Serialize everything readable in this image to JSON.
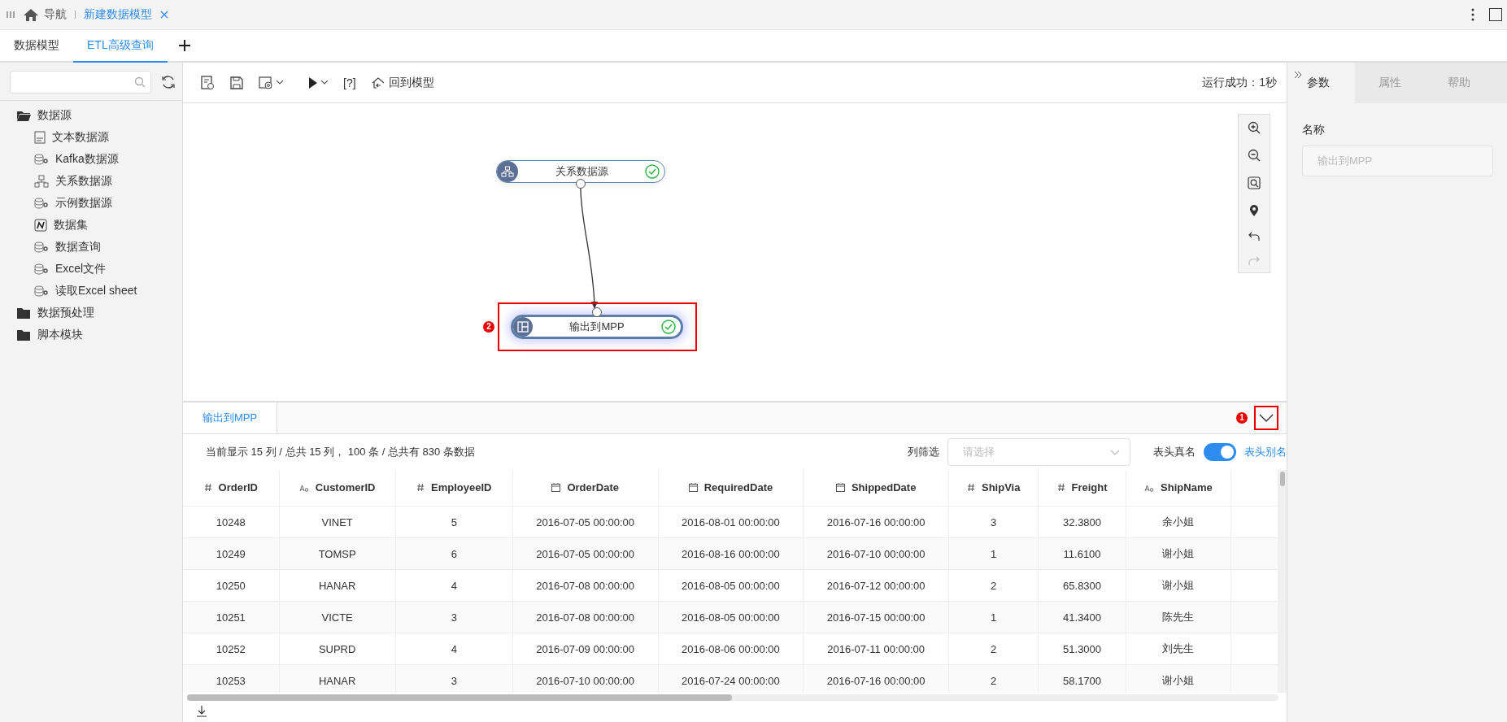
{
  "top_bar": {
    "nav_label": "导航",
    "open_tab": {
      "title": "新建数据模型",
      "selected": true
    }
  },
  "model_tabs": [
    {
      "label": "数据模型",
      "selected": false
    },
    {
      "label": "ETL高级查询",
      "selected": true
    }
  ],
  "sidebar": {
    "items": [
      {
        "label": "数据源",
        "kind": "folder",
        "expanded": true,
        "children": [
          {
            "label": "文本数据源",
            "kind": "text"
          },
          {
            "label": "Kafka数据源",
            "kind": "db"
          },
          {
            "label": "关系数据源",
            "kind": "relation"
          },
          {
            "label": "示例数据源",
            "kind": "db"
          },
          {
            "label": "数据集",
            "kind": "dataset"
          },
          {
            "label": "数据查询",
            "kind": "db"
          },
          {
            "label": "Excel文件",
            "kind": "db"
          },
          {
            "label": "读取Excel sheet",
            "kind": "db"
          }
        ]
      },
      {
        "label": "数据预处理",
        "kind": "folder",
        "expanded": false
      },
      {
        "label": "脚本模块",
        "kind": "folder",
        "expanded": false
      }
    ]
  },
  "toolbar": {
    "help": "[?]",
    "back_label": "回到模型",
    "status": "运行成功：1秒"
  },
  "canvas": {
    "nodes": [
      {
        "label": "关系数据源",
        "kind": "relation",
        "succeeded": true,
        "selected": false
      },
      {
        "label": "输出到MPP",
        "kind": "output",
        "succeeded": true,
        "selected": true,
        "badge": "2"
      }
    ],
    "tools": [
      {
        "kind": "zoom-in",
        "disabled": false
      },
      {
        "kind": "zoom-out",
        "disabled": false
      },
      {
        "kind": "fit",
        "disabled": false
      },
      {
        "kind": "locate",
        "disabled": false
      },
      {
        "kind": "undo",
        "disabled": false
      },
      {
        "kind": "redo",
        "disabled": true
      }
    ]
  },
  "result_panel": {
    "tabs": [
      {
        "label": "输出到MPP",
        "selected": true
      }
    ],
    "badge": "1",
    "summary": "当前显示 15 列 / 总共 15 列， 100 条 / 总共有 830 条数据",
    "filter": {
      "label": "列筛选",
      "placeholder": "请选择"
    },
    "header_toggle": {
      "label": "表头真名",
      "on": true,
      "alt_label": "表头别名"
    },
    "table": {
      "columns": [
        {
          "name": "OrderID",
          "kind": "number"
        },
        {
          "name": "CustomerID",
          "kind": "text"
        },
        {
          "name": "EmployeeID",
          "kind": "number"
        },
        {
          "name": "OrderDate",
          "kind": "date"
        },
        {
          "name": "RequiredDate",
          "kind": "date"
        },
        {
          "name": "ShippedDate",
          "kind": "date"
        },
        {
          "name": "ShipVia",
          "kind": "number"
        },
        {
          "name": "Freight",
          "kind": "number"
        },
        {
          "name": "ShipName",
          "kind": "text"
        }
      ],
      "rows": [
        [
          "10248",
          "VINET",
          "5",
          "2016-07-05 00:00:00",
          "2016-08-01 00:00:00",
          "2016-07-16 00:00:00",
          "3",
          "32.3800",
          "余小姐"
        ],
        [
          "10249",
          "TOMSP",
          "6",
          "2016-07-05 00:00:00",
          "2016-08-16 00:00:00",
          "2016-07-10 00:00:00",
          "1",
          "11.6100",
          "谢小姐"
        ],
        [
          "10250",
          "HANAR",
          "4",
          "2016-07-08 00:00:00",
          "2016-08-05 00:00:00",
          "2016-07-12 00:00:00",
          "2",
          "65.8300",
          "谢小姐"
        ],
        [
          "10251",
          "VICTE",
          "3",
          "2016-07-08 00:00:00",
          "2016-08-05 00:00:00",
          "2016-07-15 00:00:00",
          "1",
          "41.3400",
          "陈先生"
        ],
        [
          "10252",
          "SUPRD",
          "4",
          "2016-07-09 00:00:00",
          "2016-08-06 00:00:00",
          "2016-07-11 00:00:00",
          "2",
          "51.3000",
          "刘先生"
        ],
        [
          "10253",
          "HANAR",
          "3",
          "2016-07-10 00:00:00",
          "2016-07-24 00:00:00",
          "2016-07-16 00:00:00",
          "2",
          "58.1700",
          "谢小姐"
        ]
      ]
    }
  },
  "properties": {
    "tabs": [
      {
        "label": "参数",
        "selected": true
      },
      {
        "label": "属性",
        "selected": false
      },
      {
        "label": "帮助",
        "selected": false
      }
    ],
    "field": {
      "label": "名称",
      "value": "输出到MPP",
      "disabled": true
    }
  }
}
